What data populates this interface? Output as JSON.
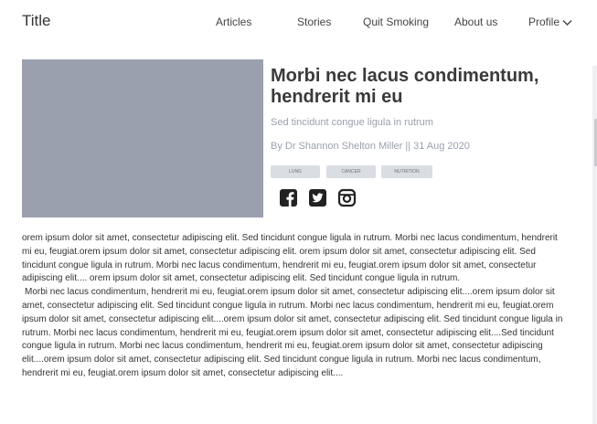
{
  "header": {
    "site_title": "Title",
    "nav": {
      "articles": "Articles",
      "stories": "Stories",
      "quit_smoking": "Quit Smoking",
      "about_us": "About us",
      "profile": "Profile"
    }
  },
  "article": {
    "title": "Morbi nec lacus condimentum, hendrerit mi eu",
    "subtitle": "Sed tincidunt congue ligula in rutrum",
    "byline": "By Dr Shannon Shelton Miller || 31 Aug 2020",
    "tags": [
      "LUNG",
      "CANCER",
      "NUTRITION"
    ],
    "social_icons": [
      "facebook-icon",
      "twitter-icon",
      "instagram-icon"
    ],
    "paragraphs": [
      "orem ipsum dolor sit amet, consectetur adipiscing elit. Sed tincidunt congue ligula in rutrum. Morbi nec lacus condimentum, hendrerit mi eu, feugiat.orem ipsum dolor sit amet, consectetur adipiscing elit. orem ipsum dolor sit amet, consectetur adipiscing elit. Sed tincidunt congue ligula in rutrum. Morbi nec lacus condimentum, hendrerit mi eu, feugiat.orem ipsum dolor sit amet, consectetur adipiscing elit.... orem ipsum dolor sit amet, consectetur adipiscing elit. Sed tincidunt congue ligula in rutrum.",
      "Morbi nec lacus condimentum, hendrerit mi eu, feugiat.orem ipsum dolor sit amet, consectetur adipiscing elit....orem ipsum dolor sit amet, consectetur adipiscing elit. Sed tincidunt congue ligula in rutrum. Morbi nec lacus condimentum, hendrerit mi eu, feugiat.orem ipsum dolor sit amet, consectetur adipiscing elit....orem ipsum dolor sit amet, consectetur adipiscing elit. Sed tincidunt congue ligula in rutrum. Morbi nec lacus condimentum, hendrerit mi eu, feugiat.orem ipsum dolor sit amet, consectetur adipiscing elit....Sed tincidunt congue ligula in rutrum. Morbi nec lacus condimentum, hendrerit mi eu, feugiat.orem ipsum dolor sit amet, consectetur adipiscing elit....orem ipsum dolor sit amet, consectetur adipiscing elit. Sed tincidunt congue ligula in rutrum. Morbi nec lacus condimentum, hendrerit mi eu, feugiat.orem ipsum dolor sit amet, consectetur adipiscing elit...."
    ]
  },
  "colors": {
    "image_placeholder": "#9aa0ad",
    "tag_bg": "#dadde2",
    "muted_text": "#9aa0ad",
    "title_text": "#3a3a3a",
    "icon": "#222222"
  }
}
